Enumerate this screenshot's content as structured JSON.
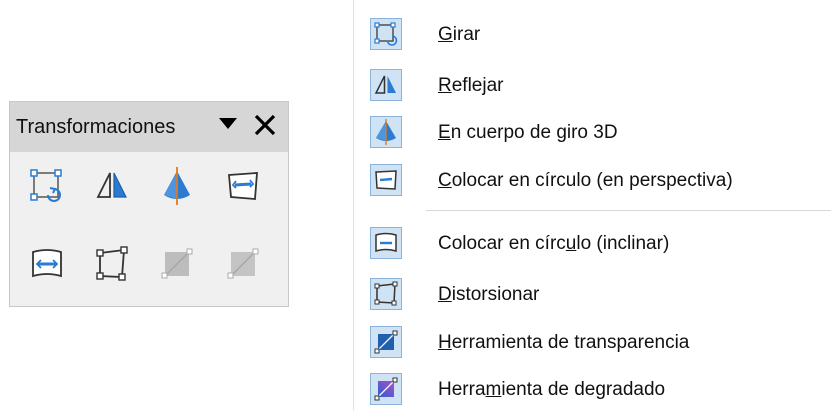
{
  "toolbar": {
    "title": "Transformaciones",
    "buttons": [
      {
        "icon": "rotate-icon",
        "enabled": true
      },
      {
        "icon": "flip-icon",
        "enabled": true
      },
      {
        "icon": "3d-rotation-object-icon",
        "enabled": true
      },
      {
        "icon": "circle-perspective-icon",
        "enabled": true
      },
      {
        "icon": "circle-slant-icon",
        "enabled": true
      },
      {
        "icon": "distort-icon",
        "enabled": true
      },
      {
        "icon": "transparency-tool-icon",
        "enabled": false
      },
      {
        "icon": "gradient-tool-icon",
        "enabled": false
      }
    ]
  },
  "menu": {
    "items": [
      {
        "pre": "",
        "key": "G",
        "post": "irar",
        "icon": "rotate-icon"
      },
      {
        "pre": "",
        "key": "R",
        "post": "eflejar",
        "icon": "flip-icon"
      },
      {
        "pre": "",
        "key": "E",
        "post": "n cuerpo de giro 3D",
        "icon": "3d-rotation-object-icon"
      },
      {
        "pre": "",
        "key": "C",
        "post": "olocar en círculo (en perspectiva)",
        "icon": "circle-perspective-icon"
      },
      {
        "pre": "Colocar en círc",
        "key": "u",
        "post": "lo (inclinar)",
        "icon": "circle-slant-icon"
      },
      {
        "pre": "",
        "key": "D",
        "post": "istorsionar",
        "icon": "distort-icon"
      },
      {
        "pre": "",
        "key": "H",
        "post": "erramienta de transparencia",
        "icon": "transparency-tool-icon"
      },
      {
        "pre": "Herra",
        "key": "m",
        "post": "ienta de degradado",
        "icon": "gradient-tool-icon"
      }
    ]
  }
}
